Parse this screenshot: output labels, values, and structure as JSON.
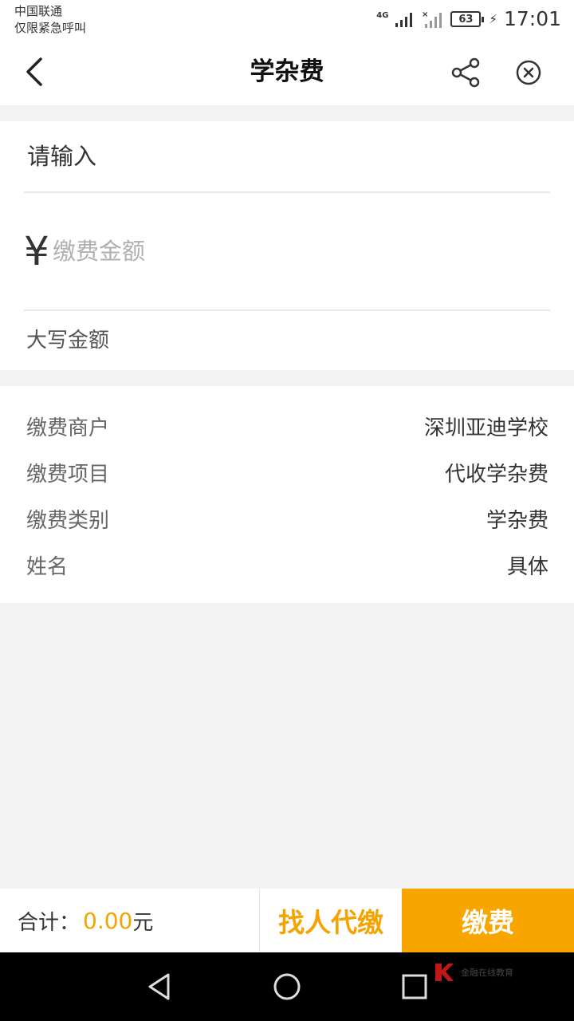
{
  "status_bar": {
    "carrier": "中国联通",
    "emergency_text": "仅限紧急呼叫",
    "network": "4G",
    "battery": "63",
    "time": "17:01"
  },
  "nav": {
    "title": "学杂费",
    "back_icon": "chevron-left-icon",
    "share_icon": "share-icon",
    "close_icon": "close-circle-icon"
  },
  "form": {
    "remark_placeholder": "请输入",
    "currency_symbol": "¥",
    "amount_placeholder": "缴费金额",
    "capital_label": "大写金额"
  },
  "details": [
    {
      "label": "缴费商户",
      "value": "深圳亚迪学校"
    },
    {
      "label": "缴费项目",
      "value": "代收学杂费"
    },
    {
      "label": "缴费类别",
      "value": "学杂费"
    },
    {
      "label": "姓名",
      "value": "具体"
    }
  ],
  "footer": {
    "total_label": "合计：",
    "total_amount": "0.00",
    "total_unit": "元",
    "proxy_button": "找人代缴",
    "pay_button": "缴费"
  },
  "watermark": {
    "text": "金融在线教育"
  },
  "colors": {
    "accent": "#f9a500",
    "accent_text": "#f5a300",
    "background": "#f3f3f3"
  }
}
